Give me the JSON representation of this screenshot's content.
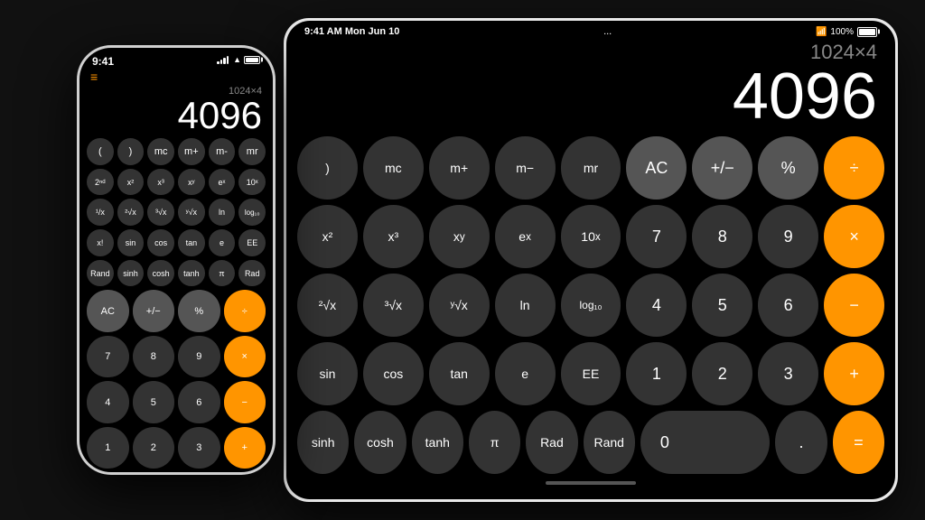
{
  "scene": {
    "background": "#111"
  },
  "ipad": {
    "status": {
      "time": "9:41 AM  Mon Jun 10",
      "dots": "...",
      "wifi": "100%"
    },
    "display": {
      "expression": "1024×4",
      "result": "4096"
    },
    "rows": [
      [
        ")",
        "mc",
        "m+",
        "m−",
        "mr",
        "AC",
        "+/−",
        "%",
        "÷"
      ],
      [
        "x²",
        "x³",
        "xʸ",
        "eˣ",
        "10ˣ",
        "7",
        "8",
        "9",
        "×"
      ],
      [
        "²√x",
        "³√x",
        "ʸ√x",
        "ln",
        "log₁₀",
        "4",
        "5",
        "6",
        "−"
      ],
      [
        "sin",
        "cos",
        "tan",
        "e",
        "EE",
        "1",
        "2",
        "3",
        "+"
      ],
      [
        "sinh",
        "cosh",
        "tanh",
        "π",
        "Rad",
        "Rand",
        "0",
        ".",
        "="
      ]
    ],
    "btn_types": [
      [
        "dark",
        "dark",
        "dark",
        "dark",
        "dark",
        "mid",
        "mid",
        "mid",
        "orange"
      ],
      [
        "dark",
        "dark",
        "dark",
        "dark",
        "dark",
        "dark",
        "dark",
        "dark",
        "orange"
      ],
      [
        "dark",
        "dark",
        "dark",
        "dark",
        "dark",
        "dark",
        "dark",
        "dark",
        "orange"
      ],
      [
        "dark",
        "dark",
        "dark",
        "dark",
        "dark",
        "dark",
        "dark",
        "dark",
        "orange"
      ],
      [
        "dark",
        "dark",
        "dark",
        "dark",
        "dark",
        "dark",
        "dark",
        "dark",
        "orange"
      ]
    ]
  },
  "iphone": {
    "status": {
      "time": "9:41",
      "wifi": "▲"
    },
    "display": {
      "expression": "1024×4",
      "result": "4096"
    },
    "rows": [
      [
        "(",
        ")",
        "mc",
        "m+",
        "m−",
        "mr"
      ],
      [
        "2ⁿᵈ",
        "x²",
        "x³",
        "xʸ",
        "eˣ",
        "10ˣ"
      ],
      [
        "¹/x",
        "²√x",
        "³√x",
        "ʸ√x",
        "ln",
        "log₁₀"
      ],
      [
        "x!",
        "sin",
        "cos",
        "tan",
        "e",
        "EE"
      ],
      [
        "Rand",
        "sinh",
        "cosh",
        "tanh",
        "π",
        "Rad"
      ],
      [
        "AC",
        "+/−",
        "%",
        "÷"
      ],
      [
        "7",
        "8",
        "9",
        "×"
      ],
      [
        "4",
        "5",
        "6",
        "−"
      ],
      [
        "1",
        "2",
        "3",
        "+"
      ]
    ]
  }
}
